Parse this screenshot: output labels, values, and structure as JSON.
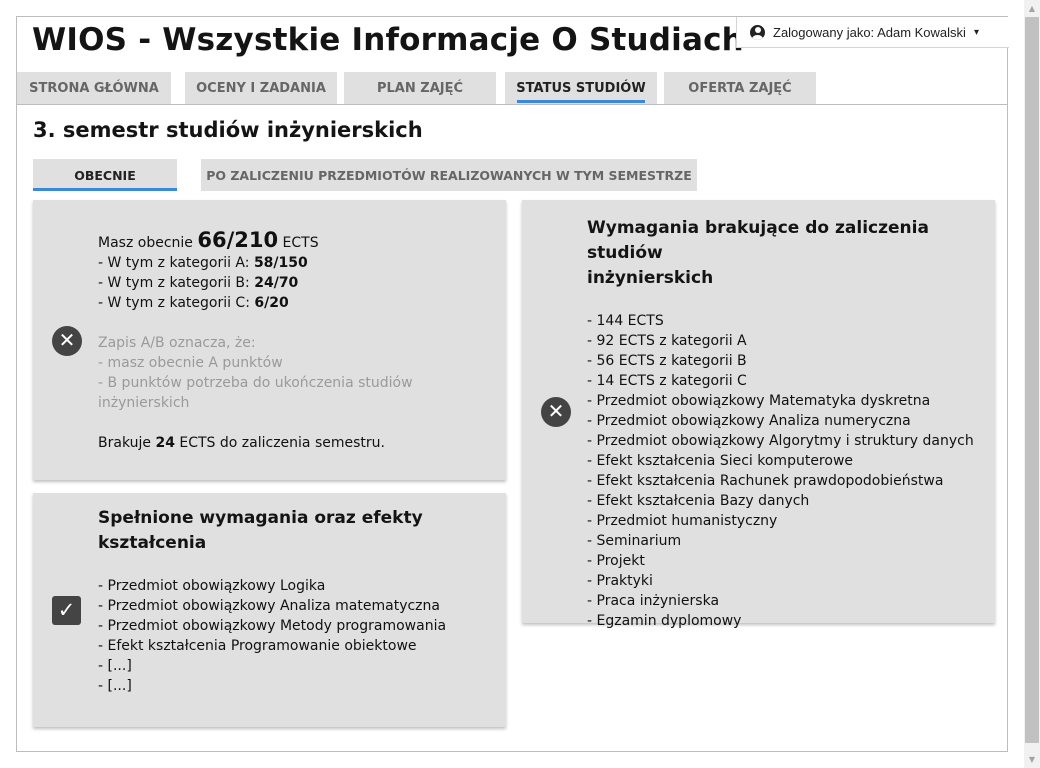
{
  "app": {
    "title": "WIOS - Wszystkie Informacje O Studiach"
  },
  "user_menu": {
    "label": "Zalogowany jako: Adam Kowalski",
    "icon": "account-circle-icon",
    "caret": "▾"
  },
  "main_tabs": [
    {
      "label": "STRONA GŁÓWNA",
      "active": false
    },
    {
      "label": "OCENY I ZADANIA",
      "active": false
    },
    {
      "label": "PLAN ZAJĘĆ",
      "active": false
    },
    {
      "label": "STATUS STUDIÓW",
      "active": true
    },
    {
      "label": "OFERTA ZAJĘĆ",
      "active": false
    }
  ],
  "section": {
    "title": "3. semestr studiów inżynierskich"
  },
  "sub_tabs": [
    {
      "label": "OBECNIE",
      "active": true
    },
    {
      "label": "PO ZALICZENIU PRZEDMIOTÓW REALIZOWANYCH W TYM SEMESTRZE",
      "active": false
    }
  ],
  "ects_card": {
    "status_icon": "x-circle-icon",
    "intro_prefix": "Masz obecnie ",
    "total_value": "66/210",
    "intro_suffix": " ECTS",
    "cat_a_prefix": "- W tym z kategorii A: ",
    "cat_a_value": "58/150",
    "cat_b_prefix": "- W tym z kategorii B: ",
    "cat_b_value": "24/70",
    "cat_c_prefix": "- W tym z kategorii C: ",
    "cat_c_value": "6/20",
    "note_lines": [
      "Zapis A/B oznacza, że:",
      "- masz obecnie A punktów",
      "- B punktów potrzeba do ukończenia studiów",
      "inżynierskich"
    ],
    "missing_prefix": "Brakuje ",
    "missing_value": "24",
    "missing_suffix": " ECTS do zaliczenia semestru."
  },
  "fulfilled_card": {
    "status_icon": "check-box-icon",
    "heading_lines": [
      "Spełnione wymagania oraz efekty",
      "kształcenia"
    ],
    "items": [
      "- Przedmiot obowiązkowy Logika",
      "- Przedmiot obowiązkowy Analiza matematyczna",
      "- Przedmiot obowiązkowy Metody programowania",
      "- Efekt kształcenia Programowanie obiektowe",
      "- [...]",
      "- [...]"
    ]
  },
  "missing_card": {
    "status_icon": "x-circle-icon",
    "heading_lines": [
      "Wymagania brakujące do zaliczenia studiów",
      "inżynierskich"
    ],
    "items": [
      "- 144 ECTS",
      "- 92 ECTS z kategorii A",
      "- 56 ECTS z kategorii B",
      "- 14 ECTS z kategorii C",
      "- Przedmiot obowiązkowy Matematyka dyskretna",
      "- Przedmiot obowiązkowy Analiza numeryczna",
      "- Przedmiot obowiązkowy Algorytmy i struktury danych",
      "- Efekt kształcenia Sieci komputerowe",
      "- Efekt kształcenia Rachunek prawdopodobieństwa",
      "- Efekt kształcenia Bazy danych",
      "- Przedmiot humanistyczny",
      "- Seminarium",
      "- Projekt",
      "- Praktyki",
      "- Praca inżynierska",
      "- Egzamin dyplomowy"
    ]
  },
  "scrollbar": {
    "up_arrow": "▲",
    "down_arrow": "▼"
  },
  "colors": {
    "accent": "#3b8ad9",
    "card_bg": "#e0e0e0",
    "tab_bg": "#e0e0e0",
    "icon_dark": "#444444",
    "muted_text": "#9a9a9a"
  }
}
